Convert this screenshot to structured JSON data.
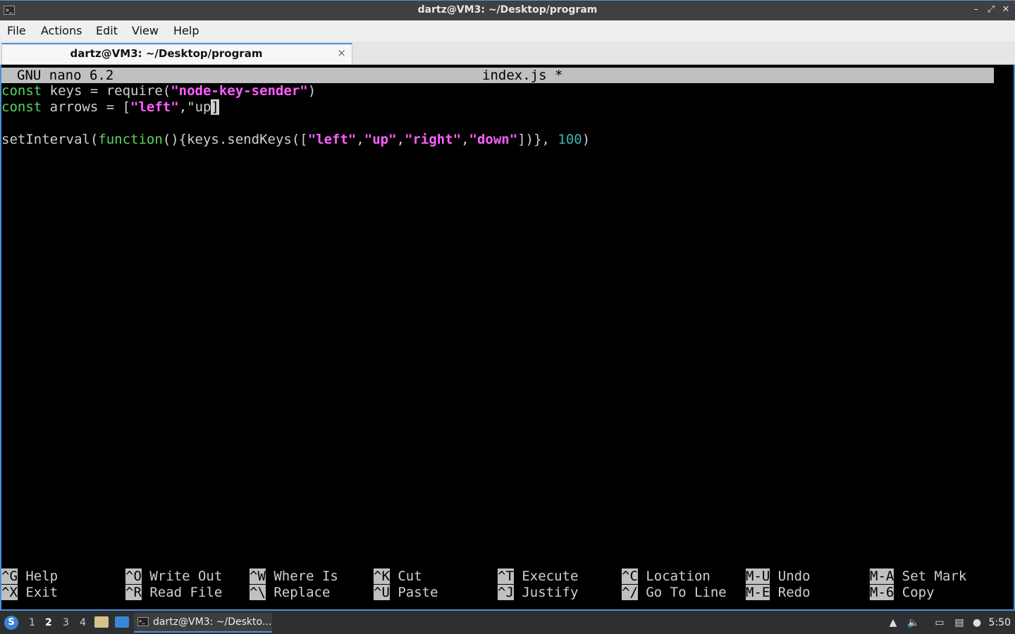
{
  "window": {
    "title": "dartz@VM3: ~/Desktop/program",
    "app_icon_glyph": ">_",
    "minimize_glyph": "–",
    "maximize_glyph": "⤢",
    "close_glyph": "✕"
  },
  "menu": {
    "file": "File",
    "actions": "Actions",
    "edit": "Edit",
    "view": "View",
    "help": "Help"
  },
  "tab": {
    "label": "dartz@VM3: ~/Desktop/program",
    "close_glyph": "×"
  },
  "nano": {
    "version": "GNU nano 6.2",
    "filename": "index.js *",
    "lines": [
      [
        {
          "t": "const",
          "c": "kw"
        },
        {
          "t": " keys = require(",
          "c": "plain"
        },
        {
          "t": "\"node-key-sender\"",
          "c": "str"
        },
        {
          "t": ")",
          "c": "plain"
        }
      ],
      [
        {
          "t": "const",
          "c": "kw"
        },
        {
          "t": " arrows = [",
          "c": "plain"
        },
        {
          "t": "\"left\"",
          "c": "str"
        },
        {
          "t": ",\"up",
          "c": "plain"
        },
        {
          "t": "]",
          "c": "cursor"
        }
      ],
      [],
      [
        {
          "t": "setInterval(",
          "c": "plain"
        },
        {
          "t": "function",
          "c": "kw"
        },
        {
          "t": "(){keys.sendKeys([",
          "c": "plain"
        },
        {
          "t": "\"left\"",
          "c": "str"
        },
        {
          "t": ",",
          "c": "plain"
        },
        {
          "t": "\"up\"",
          "c": "str"
        },
        {
          "t": ",",
          "c": "plain"
        },
        {
          "t": "\"right\"",
          "c": "str"
        },
        {
          "t": ",",
          "c": "plain"
        },
        {
          "t": "\"down\"",
          "c": "str"
        },
        {
          "t": "])}, ",
          "c": "plain"
        },
        {
          "t": "100",
          "c": "num"
        },
        {
          "t": ")",
          "c": "plain"
        }
      ]
    ],
    "shortcuts_top": [
      {
        "key": "^G",
        "label": "Help"
      },
      {
        "key": "^O",
        "label": "Write Out"
      },
      {
        "key": "^W",
        "label": "Where Is"
      },
      {
        "key": "^K",
        "label": "Cut"
      },
      {
        "key": "^T",
        "label": "Execute"
      },
      {
        "key": "^C",
        "label": "Location"
      },
      {
        "key": "M-U",
        "label": "Undo"
      },
      {
        "key": "M-A",
        "label": "Set Mark"
      }
    ],
    "shortcuts_bottom": [
      {
        "key": "^X",
        "label": "Exit"
      },
      {
        "key": "^R",
        "label": "Read File"
      },
      {
        "key": "^\\",
        "label": "Replace"
      },
      {
        "key": "^U",
        "label": "Paste"
      },
      {
        "key": "^J",
        "label": "Justify"
      },
      {
        "key": "^/",
        "label": "Go To Line"
      },
      {
        "key": "M-E",
        "label": "Redo"
      },
      {
        "key": "M-6",
        "label": "Copy"
      }
    ]
  },
  "taskbar": {
    "start_glyph": "S",
    "workspaces": [
      "1",
      "2",
      "3",
      "4"
    ],
    "active_workspace": "2",
    "task_label": "dartz@VM3: ~/Deskto...",
    "task_icon_glyph": ">_",
    "tray_icons": [
      "up-arrow-icon",
      "volume-icon",
      "network-icon",
      "clipboard-icon",
      "update-icon"
    ],
    "clock": "5:50"
  }
}
